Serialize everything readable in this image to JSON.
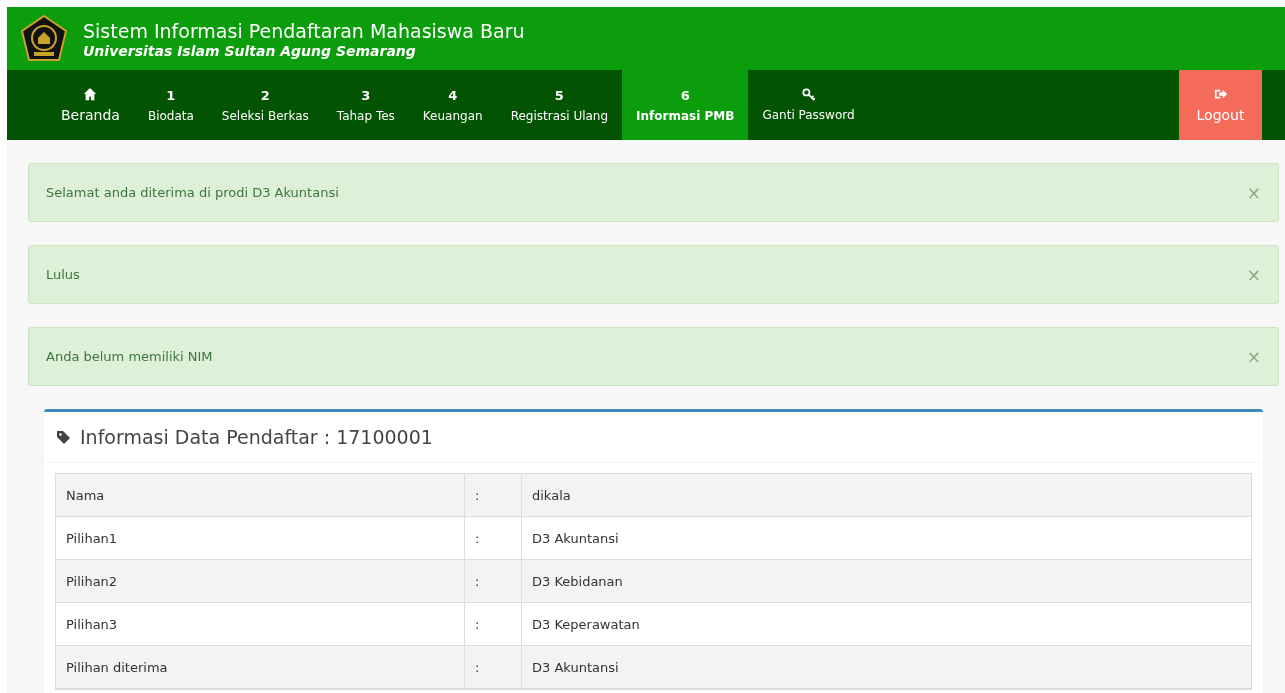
{
  "header": {
    "title": "Sistem Informasi Pendaftaran Mahasiswa Baru",
    "subtitle": "Universitas Islam Sultan Agung Semarang"
  },
  "nav": [
    {
      "kind": "home",
      "label": "Beranda",
      "selected": false
    },
    {
      "kind": "numbered",
      "number": "1",
      "label": "Biodata",
      "selected": false
    },
    {
      "kind": "numbered",
      "number": "2",
      "label": "Seleksi Berkas",
      "selected": false
    },
    {
      "kind": "numbered",
      "number": "3",
      "label": "Tahap Tes",
      "selected": false
    },
    {
      "kind": "numbered",
      "number": "4",
      "label": "Keuangan",
      "selected": false
    },
    {
      "kind": "numbered",
      "number": "5",
      "label": "Registrasi Ulang",
      "selected": false
    },
    {
      "kind": "numbered",
      "number": "6",
      "label": "Informasi PMB",
      "selected": true
    },
    {
      "kind": "key",
      "label": "Ganti Password",
      "selected": false
    }
  ],
  "logout": {
    "label": "Logout"
  },
  "alerts": [
    {
      "text": "Selamat anda diterima di prodi D3 Akuntansi",
      "close": "×"
    },
    {
      "text": "Lulus",
      "close": "×"
    },
    {
      "text": "Anda belum memiliki NIM",
      "close": "×"
    }
  ],
  "card": {
    "title": "Informasi Data Pendaftar : 17100001",
    "rows": [
      {
        "label": "Nama",
        "separator": ":",
        "value": "dikala"
      },
      {
        "label": "Pilihan1",
        "separator": ":",
        "value": "D3 Akuntansi"
      },
      {
        "label": "Pilihan2",
        "separator": ":",
        "value": "D3 Kebidanan"
      },
      {
        "label": "Pilihan3",
        "separator": ":",
        "value": "D3 Keperawatan"
      },
      {
        "label": "Pilihan diterima",
        "separator": ":",
        "value": "D3 Akuntansi"
      }
    ]
  }
}
